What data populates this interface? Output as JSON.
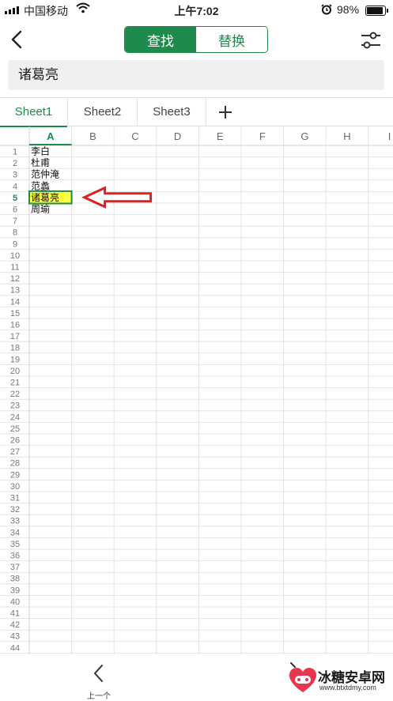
{
  "status": {
    "carrier": "中国移动",
    "time": "上午7:02",
    "battery_pct": "98%",
    "battery_level": 0.98
  },
  "nav": {
    "find_label": "查找",
    "replace_label": "替换",
    "active_tab": "find"
  },
  "search": {
    "value": "诸葛亮"
  },
  "sheets": [
    {
      "label": "Sheet1",
      "active": true
    },
    {
      "label": "Sheet2",
      "active": false
    },
    {
      "label": "Sheet3",
      "active": false
    }
  ],
  "grid": {
    "columns": [
      "A",
      "B",
      "C",
      "D",
      "E",
      "F",
      "G",
      "H",
      "I"
    ],
    "row_count": 44,
    "selected_column": "A",
    "selected_row": 5,
    "cells": [
      {
        "row": 1,
        "col": "A",
        "value": "李白"
      },
      {
        "row": 2,
        "col": "A",
        "value": "杜甫"
      },
      {
        "row": 3,
        "col": "A",
        "value": "范仲淹"
      },
      {
        "row": 4,
        "col": "A",
        "value": "范蠡"
      },
      {
        "row": 5,
        "col": "A",
        "value": "诸葛亮",
        "highlighted": true
      },
      {
        "row": 6,
        "col": "A",
        "value": "周瑜"
      }
    ],
    "highlight_color": "#ffff3c",
    "selection_color": "#1e8a4c",
    "annotation": {
      "type": "arrow",
      "points_to": "A5",
      "color": "#e02020"
    }
  },
  "bottom": {
    "prev_label": "上一个"
  },
  "watermark": {
    "title": "冰糖安卓网",
    "url": "www.btxtdmy.com"
  },
  "icons": [
    "signal-icon",
    "wifi-icon",
    "alarm-icon",
    "battery-icon",
    "back-chevron-icon",
    "settings-sliders-icon",
    "plus-icon",
    "chevron-left-icon",
    "chevron-right-icon",
    "watermark-logo-icon"
  ],
  "colors": {
    "accent": "#1e8a4c",
    "arrow": "#e02020"
  }
}
